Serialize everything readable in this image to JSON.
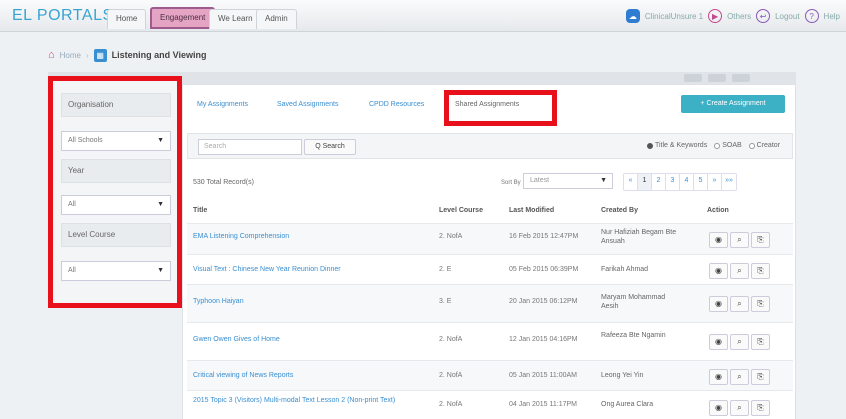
{
  "topbar": {
    "logo": "EL PORTALS",
    "nav": [
      "Home",
      "Engagement",
      "We Learn",
      "Admin"
    ],
    "active_nav": "Engagement",
    "user": "ClinicalUnsure 1",
    "links": [
      "Others",
      "Logout",
      "Help"
    ]
  },
  "breadcrumb": {
    "home": "Home",
    "current": "Listening and Viewing"
  },
  "sidebar": {
    "organisation_label": "Organisation",
    "school_value": "All Schools",
    "year_label": "Year",
    "year_value": "All",
    "level_course_label": "Level Course",
    "level_course_value": "All"
  },
  "tabs": [
    "My Assignments",
    "Saved Assignments",
    "CPDD Resources",
    "Shared Assignments"
  ],
  "active_tab": "Shared Assignments",
  "create_button": "+ Create Assignment",
  "search": {
    "placeholder": "Search",
    "button": "Q Search",
    "options": [
      "Title & Keywords",
      "SOAB",
      "Creator"
    ],
    "selected": "Title & Keywords"
  },
  "results_text": "530 Total Record(s)",
  "sort": {
    "label": "Sort By",
    "value": "Latest"
  },
  "pagination": [
    "«",
    "1",
    "2",
    "3",
    "4",
    "5",
    "»",
    "»»"
  ],
  "active_page": "1",
  "table": {
    "headers": [
      "Title",
      "Level Course",
      "Last Modified",
      "Created By",
      "Action"
    ],
    "rows": [
      {
        "title": "EMA Listening Comprehension",
        "level": "2. NofA",
        "modified": "16 Feb 2015 12:47PM",
        "by": "Nur Hafiziah Begam Bte Ansuah"
      },
      {
        "title": "Visual Text : Chinese New Year Reunion Dinner",
        "level": "2. E",
        "modified": "05 Feb 2015 06:39PM",
        "by": "Farikah Ahmad"
      },
      {
        "title": "Typhoon Haiyan",
        "level": "3. E",
        "modified": "20 Jan 2015 06:12PM",
        "by": "Maryam Mohammad Aesih"
      },
      {
        "title": "Gwen Owen Gives of Home",
        "level": "2. NofA",
        "modified": "12 Jan 2015 04:16PM",
        "by": "Rafeeza Bte Ngamin"
      },
      {
        "title": "Critical viewing of News Reports",
        "level": "2. NofA",
        "modified": "05 Jan 2015 11:00AM",
        "by": "Leong Yei Yin"
      },
      {
        "title": "2015 Topic 3 (Visitors) Multi-modal Text Lesson 2 (Non-print Text)",
        "level": "2. NofA",
        "modified": "04 Jan 2015 11:17PM",
        "by": "Ong Aurea Clara"
      }
    ]
  },
  "colors": {
    "accent_blue": "#3a8fd1",
    "highlight_red": "#e8111b",
    "create_teal": "#3cb0c4",
    "nav_active": "#e6a4c4"
  }
}
